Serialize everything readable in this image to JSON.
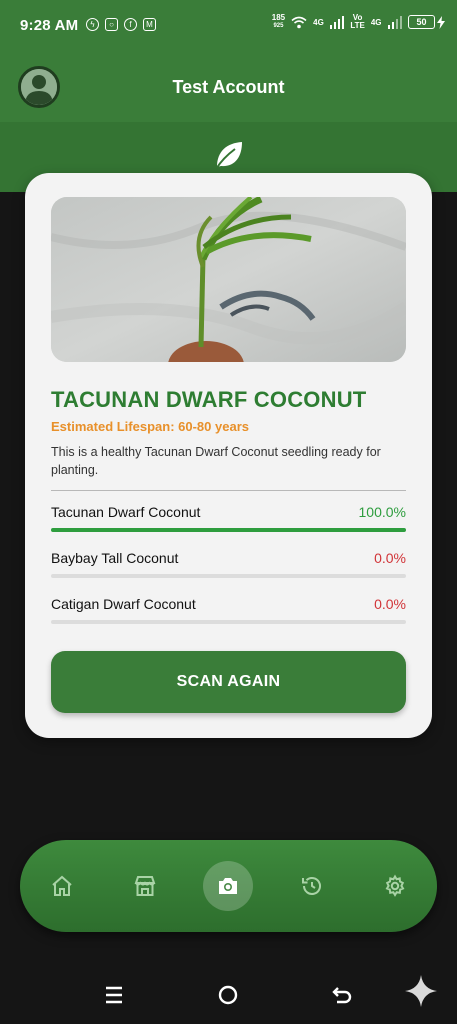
{
  "status_bar": {
    "time": "9:28 AM",
    "notifications": [
      "messenger-icon",
      "instagram-icon",
      "facebook-icon",
      "gmail-icon"
    ],
    "net_speed_top": "185",
    "net_speed_bottom": "925",
    "sim1": "4G",
    "sim2_top": "Vo",
    "sim2_bottom": "LTE",
    "sim3": "4G",
    "battery": "50"
  },
  "header": {
    "title": "Test Account"
  },
  "result": {
    "name": "TACUNAN DWARF COCONUT",
    "lifespan": "Estimated Lifespan: 60-80 years",
    "description": "This is a healthy Tacunan Dwarf Coconut seedling ready for planting.",
    "predictions": [
      {
        "label": "Tacunan Dwarf Coconut",
        "value": "100.0%",
        "fraction": 1.0,
        "color": "#2e9d3e"
      },
      {
        "label": "Baybay Tall Coconut",
        "value": "0.0%",
        "fraction": 0.0,
        "color": "#d13438"
      },
      {
        "label": "Catigan Dwarf Coconut",
        "value": "0.0%",
        "fraction": 0.0,
        "color": "#d13438"
      }
    ],
    "scan_button": "SCAN AGAIN"
  },
  "nav": {
    "items": [
      "home-icon",
      "store-icon",
      "camera-icon",
      "history-icon",
      "settings-icon"
    ],
    "active": "camera-icon"
  },
  "colors": {
    "primary": "#3a7d39",
    "title_green": "#2e7d32",
    "lifespan_orange": "#e8902a"
  }
}
